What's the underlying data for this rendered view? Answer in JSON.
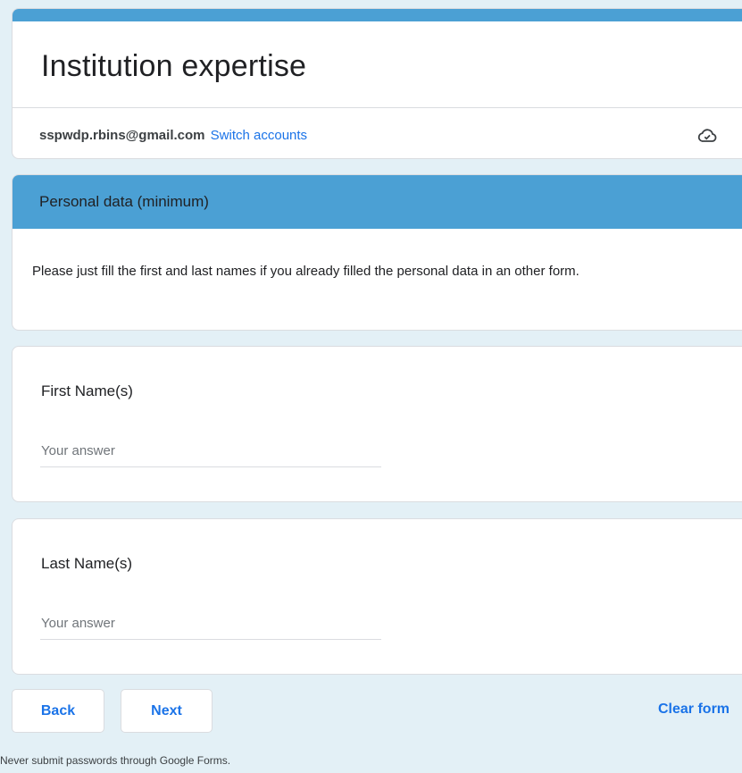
{
  "form": {
    "title": "Institution expertise",
    "account_email": "sspwdp.rbins@gmail.com",
    "switch_accounts_label": "Switch accounts",
    "cloud_icon": "cloud-saved-icon"
  },
  "section": {
    "title": "Personal data (minimum)",
    "description": "Please just fill the first and last names if you already filled the personal data in an other form."
  },
  "questions": [
    {
      "title": "First Name(s)",
      "placeholder": "Your answer",
      "value": ""
    },
    {
      "title": "Last Name(s)",
      "placeholder": "Your answer",
      "value": ""
    }
  ],
  "nav": {
    "back_label": "Back",
    "next_label": "Next",
    "clear_label": "Clear form"
  },
  "footer": {
    "note": "Never submit passwords through Google Forms."
  },
  "colors": {
    "accent": "#4ba0d4",
    "link": "#1a73e8",
    "background": "#e3f0f6"
  }
}
